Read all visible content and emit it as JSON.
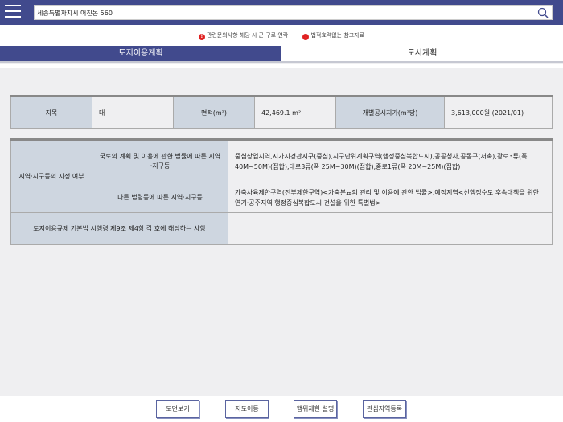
{
  "header": {
    "search_value": "세종특별자치시 어진동 560",
    "menu_icon": "hamburger-icon",
    "search_icon": "magnifier-icon"
  },
  "notices": [
    "관련문의사항 해당 시·군·구로 연락",
    "법적효력없는 참고자료"
  ],
  "tabs": [
    {
      "label": "토지이용계획",
      "active": true
    },
    {
      "label": "도시계획",
      "active": false
    }
  ],
  "summary": {
    "jimok_label": "지목",
    "jimok_value": "대",
    "area_label": "면적(m²)",
    "area_value": "42,469.1 m²",
    "price_label": "개별공시지가(m²당)",
    "price_value": "3,613,000원 (2021/01)"
  },
  "zoning": {
    "group_label": "지역·지구등의 지정 여부",
    "row1_label": "국토의 계획 및 이용에 관한 법률에 따른 지역·지구등",
    "row1_value": "중심상업지역,시가지경관지구(중심),지구단위계획구역(행정중심복합도시),공공청사,공동구(저촉),광로3류(폭 40M~50M)(접합),대로3류(폭 25M~30M)(접합),중로1류(폭 20M~25M)(접합)",
    "row2_label": "다른 법령등에 따른 지역·지구등",
    "row2_value": "가축사육제한구역(전부제한구역)<가축분뇨의 관리 및 이용에 관한 법률>,예정지역<신행정수도 후속대책을 위한 연기·공주지역 행정중심복합도시 건설을 위한 특별법>",
    "row3_label": "토지이용규제 기본법 시행령 제9조 제4항 각 호에 해당하는 사항",
    "row3_value": ""
  },
  "footer": {
    "btn1": "도면보기",
    "btn2": "지도이동",
    "btn3": "행위제한 설명",
    "btn4": "관심지역등록"
  }
}
